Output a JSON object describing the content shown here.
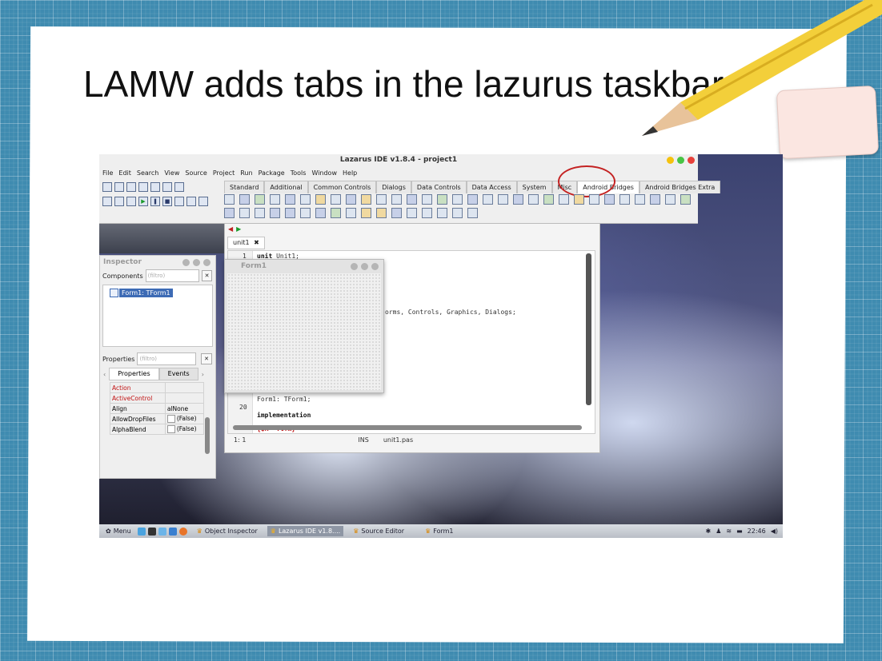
{
  "slide": {
    "title": "LAMW adds tabs in the lazurus taskbar:"
  },
  "ide": {
    "window_title": "Lazarus IDE v1.8.4 - project1",
    "menu": [
      "File",
      "Edit",
      "Search",
      "View",
      "Source",
      "Project",
      "Run",
      "Package",
      "Tools",
      "Window",
      "Help"
    ],
    "palette_tabs": [
      "Standard",
      "Additional",
      "Common Controls",
      "Dialogs",
      "Data Controls",
      "Data Access",
      "System",
      "Misc",
      "Android Bridges",
      "Android Bridges Extra"
    ],
    "highlighted_tab": "Android Bridges",
    "highlight_color": "#c42222"
  },
  "editor": {
    "tab_label": "unit1",
    "close_glyph": "✖",
    "lines": {
      "l1_num": "1",
      "l1_kw": "unit",
      "l1_rest": "Unit1;",
      "uses_rest": "orms, Controls, Graphics, Dialogs;",
      "form1_decl": "Form1: TForm1;",
      "l20_num": "20",
      "impl": "implementation",
      "directive": "{$R *.lfm}"
    },
    "status": {
      "position": "1: 1",
      "mode": "INS",
      "file": "unit1.pas"
    }
  },
  "inspector": {
    "title": "Inspector",
    "components_label": "Components",
    "filter_placeholder": "(filtro)",
    "tree_node": "Form1: TForm1",
    "properties_label": "Properties",
    "tabs": {
      "properties": "Properties",
      "events": "Events"
    },
    "rows": [
      {
        "name": "Action",
        "value": ""
      },
      {
        "name": "ActiveControl",
        "value": ""
      },
      {
        "name": "Align",
        "value": "alNone"
      },
      {
        "name": "AllowDropFiles",
        "value": "(False)"
      },
      {
        "name": "AlphaBlend",
        "value": "(False)"
      }
    ]
  },
  "form_designer": {
    "title": "Form1"
  },
  "taskbar": {
    "menu": "Menu",
    "tasks": [
      "Object Inspector",
      "Lazarus IDE v1.8....",
      "Source Editor",
      "Form1"
    ],
    "clock": "22:46"
  }
}
